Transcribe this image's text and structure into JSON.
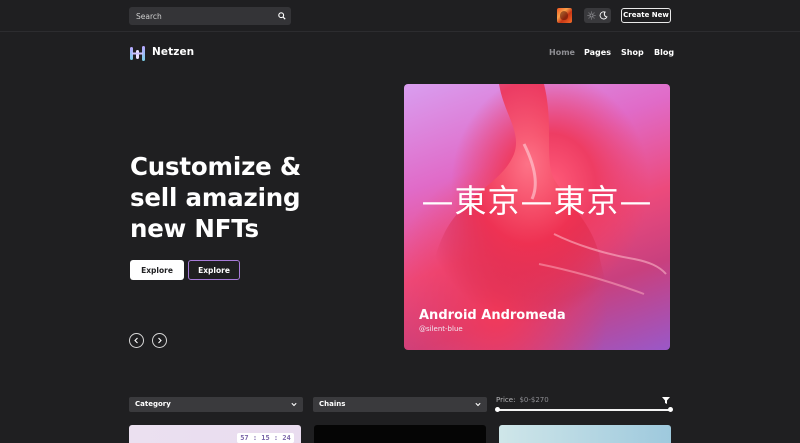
{
  "topbar": {
    "search_placeholder": "Search",
    "create_label": "Create New"
  },
  "header": {
    "brand": "Netzen",
    "nav": [
      "Home",
      "Pages",
      "Shop",
      "Blog"
    ],
    "active_nav": "Home"
  },
  "hero": {
    "title": "Customize &\nsell amazing\nnew NFTs",
    "primary_button": "Explore",
    "secondary_button": "Explore"
  },
  "feature": {
    "overlay_text": "—東京—東京—",
    "title": "Android Andromeda",
    "author": "@silent-blue"
  },
  "filters": {
    "category": "Category",
    "chains": "Chains",
    "price_label": "Price:",
    "price_range": "$0-$270"
  },
  "cards": {
    "countdown": "57 : 15 : 24 : 26"
  },
  "colors": {
    "background": "#1f1f21",
    "accent_border": "#a77bd9",
    "nav_inactive": "#8e8e93"
  },
  "icons": {
    "search": "search-icon",
    "sun": "sun-icon",
    "moon": "moon-icon",
    "logo": "netzen-logo-icon",
    "prev": "chevron-left-icon",
    "next": "chevron-right-icon",
    "filter": "filter-icon"
  }
}
